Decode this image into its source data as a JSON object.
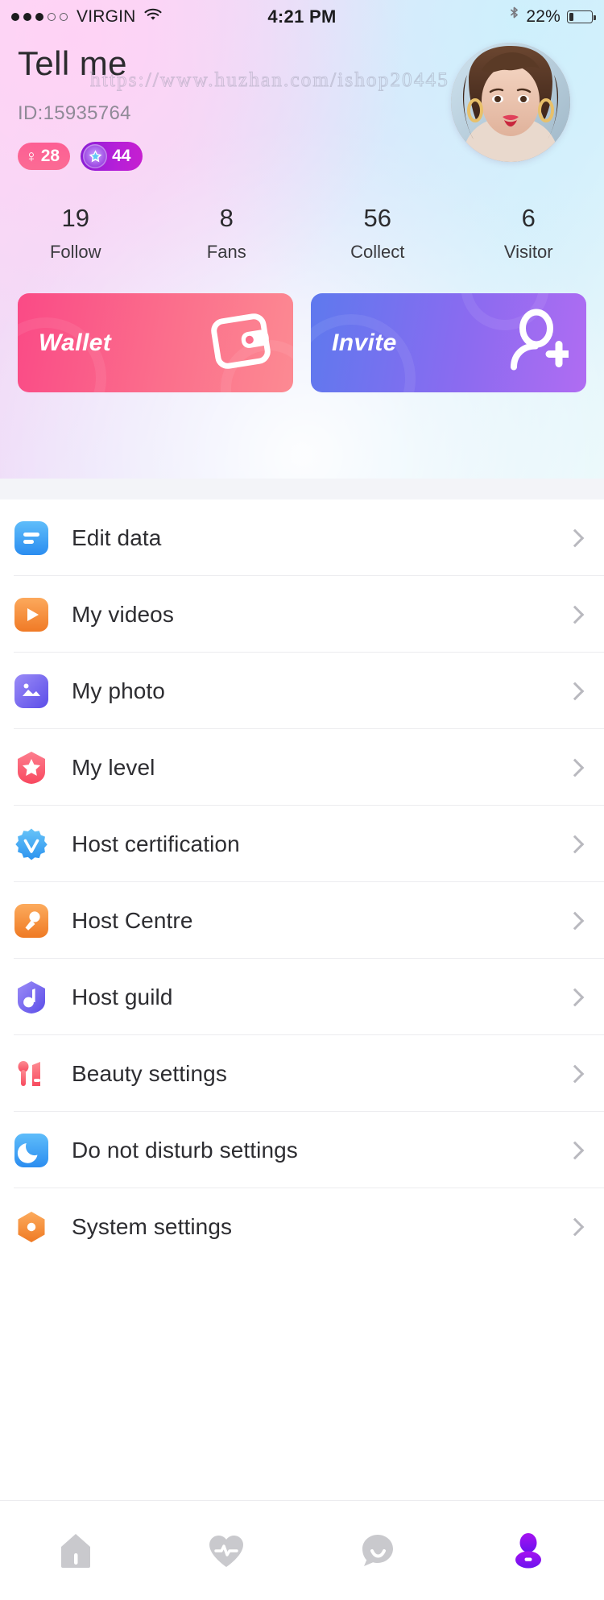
{
  "status_bar": {
    "signal_dots_filled": 3,
    "signal_dots_total": 5,
    "carrier": "VIRGIN",
    "wifi_icon": "wifi-icon",
    "time": "4:21 PM",
    "bluetooth_icon": "bluetooth-icon",
    "battery_percent": "22%",
    "battery_level": 22
  },
  "watermark": {
    "text": "https://www.huzhan.com/ishop20445"
  },
  "profile": {
    "username": "Tell me",
    "user_id": "ID:15935764",
    "avatar_alt": "user-avatar",
    "badges": [
      {
        "name": "gender-age-badge",
        "symbol": "♀",
        "value": "28",
        "color": "#fb6190"
      },
      {
        "name": "level-badge",
        "icon": "star-icon",
        "value": "44",
        "color": "#b41fd8"
      }
    ]
  },
  "stats": [
    {
      "value": "19",
      "label": "Follow"
    },
    {
      "value": "8",
      "label": "Fans"
    },
    {
      "value": "56",
      "label": "Collect"
    },
    {
      "value": "6",
      "label": "Visitor"
    }
  ],
  "action_cards": [
    {
      "label": "Wallet",
      "icon": "wallet-icon",
      "color": "#fb5a8b"
    },
    {
      "label": "Invite",
      "icon": "add-person-icon",
      "color": "#8a6bf0"
    }
  ],
  "menu": [
    {
      "label": "Edit data",
      "icon": "edit-data-icon",
      "color": "#3fa0f5"
    },
    {
      "label": "My videos",
      "icon": "video-play-icon",
      "color": "#f59140"
    },
    {
      "label": "My photo",
      "icon": "photo-icon",
      "color": "#7b6ef0"
    },
    {
      "label": "My level",
      "icon": "level-star-icon",
      "color": "#fb6372"
    },
    {
      "label": "Host certification",
      "icon": "verified-badge-icon",
      "color": "#3fa9f5"
    },
    {
      "label": "Host Centre",
      "icon": "microphone-icon",
      "color": "#f5913f"
    },
    {
      "label": "Host guild",
      "icon": "music-note-icon",
      "color": "#7b6ef0"
    },
    {
      "label": "Beauty settings",
      "icon": "cosmetics-icon",
      "color": "#fb6372"
    },
    {
      "label": "Do not disturb settings",
      "icon": "moon-icon",
      "color": "#3fa9f5"
    },
    {
      "label": "System settings",
      "icon": "settings-hex-icon",
      "color": "#f5913f"
    }
  ],
  "chevron_icon": "chevron-right-icon",
  "tab_bar": [
    {
      "name": "home",
      "icon": "home-icon",
      "active": false
    },
    {
      "name": "live",
      "icon": "heart-pulse-icon",
      "active": false
    },
    {
      "name": "message",
      "icon": "chat-bubble-icon",
      "active": false
    },
    {
      "name": "profile",
      "icon": "person-icon",
      "active": true
    }
  ],
  "colors": {
    "active_tab": "#8a12e8",
    "inactive_tab": "#c9c9cd",
    "separator": "#f3f4f8"
  }
}
